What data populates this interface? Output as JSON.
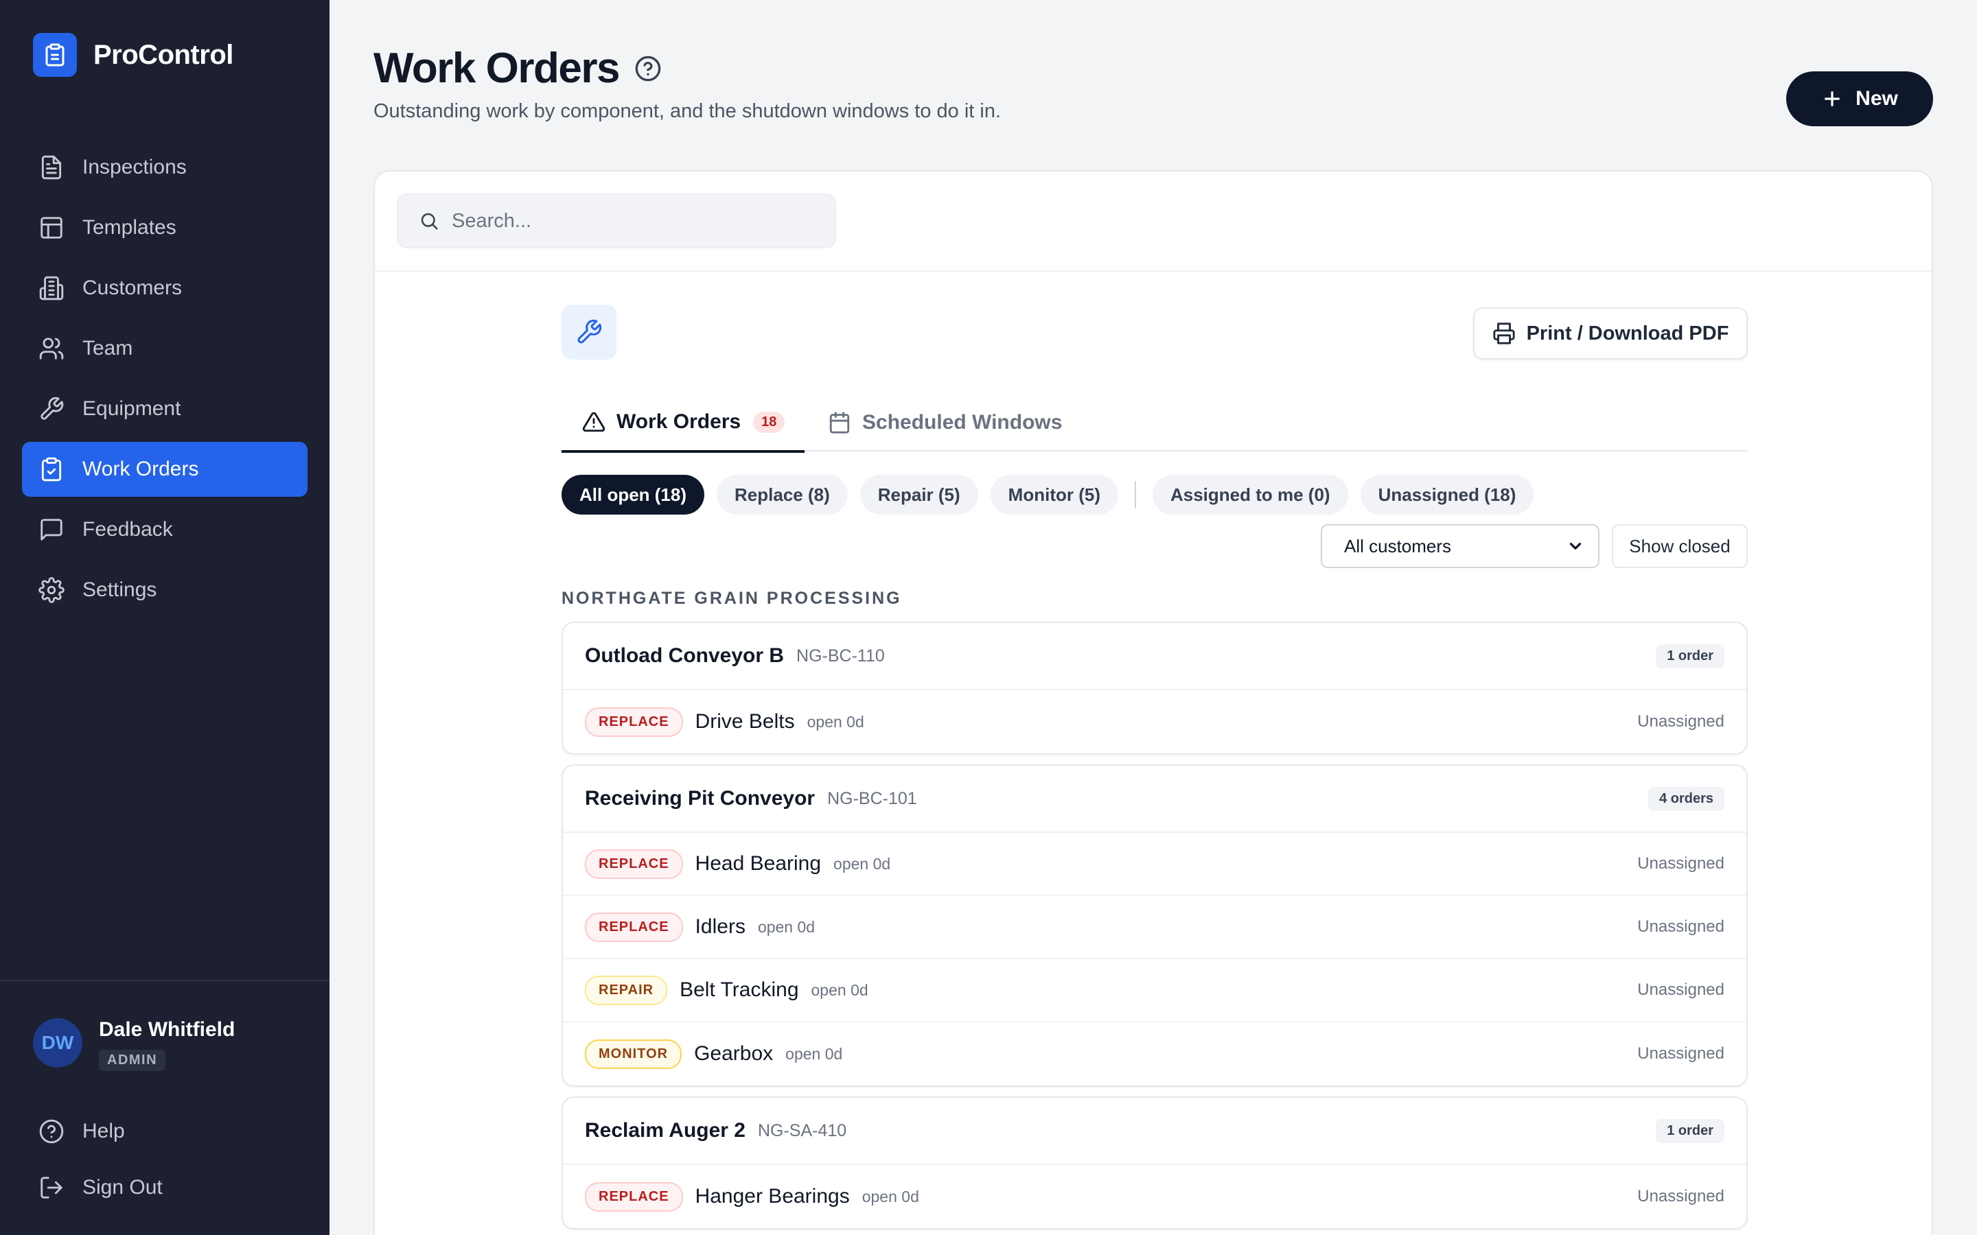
{
  "app": {
    "name": "ProControl"
  },
  "sidebar": {
    "items": [
      {
        "label": "Inspections",
        "icon": "file-text-icon"
      },
      {
        "label": "Templates",
        "icon": "layout-icon"
      },
      {
        "label": "Customers",
        "icon": "building-icon"
      },
      {
        "label": "Team",
        "icon": "users-icon"
      },
      {
        "label": "Equipment",
        "icon": "wrench-icon"
      },
      {
        "label": "Work Orders",
        "icon": "clipboard-check-icon",
        "active": true
      },
      {
        "label": "Feedback",
        "icon": "message-square-icon"
      },
      {
        "label": "Settings",
        "icon": "gear-icon"
      }
    ],
    "user": {
      "initials": "DW",
      "name": "Dale Whitfield",
      "role": "ADMIN"
    },
    "help_label": "Help",
    "signout_label": "Sign Out"
  },
  "header": {
    "title": "Work Orders",
    "subtitle": "Outstanding work by component, and the shutdown windows to do it in.",
    "new_label": "New"
  },
  "toolbar": {
    "search_placeholder": "Search...",
    "print_label": "Print / Download PDF"
  },
  "tabs": {
    "orders_label": "Work Orders",
    "orders_count": "18",
    "windows_label": "Scheduled Windows"
  },
  "filters": {
    "all_open": "All open (18)",
    "replace": "Replace (8)",
    "repair": "Repair (5)",
    "monitor": "Monitor (5)",
    "assigned_to_me": "Assigned to me (0)",
    "unassigned": "Unassigned (18)",
    "customer_select": "All customers",
    "show_closed": "Show closed"
  },
  "group": {
    "heading": "NORTHGATE GRAIN PROCESSING",
    "components": [
      {
        "name": "Outload Conveyor B",
        "code": "NG-BC-110",
        "count": "1 order",
        "orders": [
          {
            "tag": "REPLACE",
            "name": "Drive Belts",
            "age": "open 0d",
            "assignee": "Unassigned"
          }
        ]
      },
      {
        "name": "Receiving Pit Conveyor",
        "code": "NG-BC-101",
        "count": "4 orders",
        "orders": [
          {
            "tag": "REPLACE",
            "name": "Head Bearing",
            "age": "open 0d",
            "assignee": "Unassigned"
          },
          {
            "tag": "REPLACE",
            "name": "Idlers",
            "age": "open 0d",
            "assignee": "Unassigned"
          },
          {
            "tag": "REPAIR",
            "name": "Belt Tracking",
            "age": "open 0d",
            "assignee": "Unassigned"
          },
          {
            "tag": "MONITOR",
            "name": "Gearbox",
            "age": "open 0d",
            "assignee": "Unassigned"
          }
        ]
      },
      {
        "name": "Reclaim Auger 2",
        "code": "NG-SA-410",
        "count": "1 order",
        "orders": [
          {
            "tag": "REPLACE",
            "name": "Hanger Bearings",
            "age": "open 0d",
            "assignee": "Unassigned"
          }
        ]
      }
    ]
  },
  "colors": {
    "sidebar_bg": "#1c2030",
    "accent": "#2563eb",
    "primary_dark": "#0f172a",
    "replace": "#b91c1c",
    "repair_monitor": "#92400e"
  }
}
